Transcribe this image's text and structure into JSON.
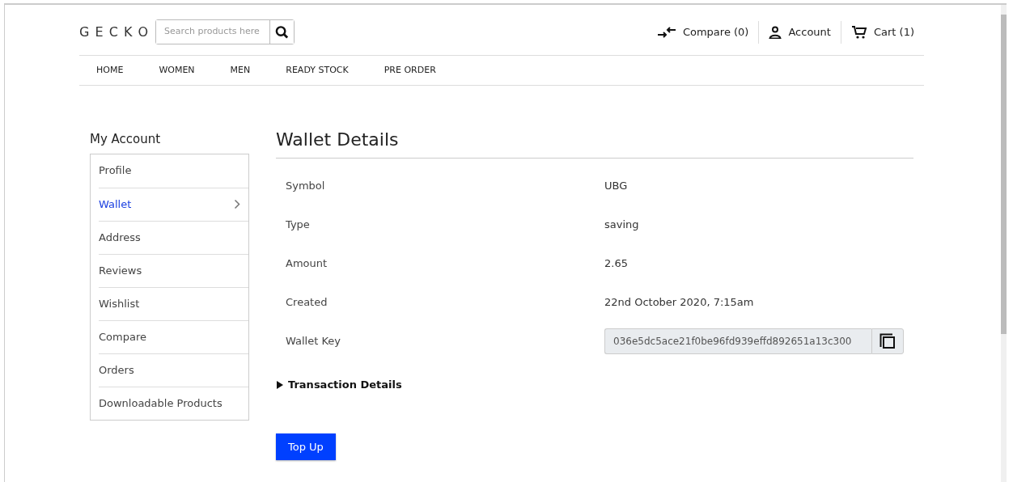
{
  "brand": "G E C K O",
  "search": {
    "placeholder": "Search products here"
  },
  "header_links": [
    {
      "kind": "compare",
      "label": "Compare (0)"
    },
    {
      "kind": "account",
      "label": "Account"
    },
    {
      "kind": "cart",
      "label": "Cart (1)"
    }
  ],
  "nav": [
    "HOME",
    "WOMEN",
    "MEN",
    "READY STOCK",
    "PRE ORDER"
  ],
  "sidebar": {
    "title": "My Account",
    "items": [
      {
        "label": "Profile",
        "selected": false
      },
      {
        "label": "Wallet",
        "selected": true
      },
      {
        "label": "Address",
        "selected": false
      },
      {
        "label": "Reviews",
        "selected": false
      },
      {
        "label": "Wishlist",
        "selected": false
      },
      {
        "label": "Compare",
        "selected": false
      },
      {
        "label": "Orders",
        "selected": false
      },
      {
        "label": "Downloadable Products",
        "selected": false
      }
    ]
  },
  "main": {
    "title": "Wallet Details",
    "fields": [
      {
        "kind": "text",
        "label": "Symbol",
        "value": "UBG"
      },
      {
        "kind": "text",
        "label": "Type",
        "value": "saving"
      },
      {
        "kind": "text",
        "label": "Amount",
        "value": "2.65"
      },
      {
        "kind": "text",
        "label": "Created",
        "value": "22nd October 2020, 7:15am"
      },
      {
        "kind": "key",
        "label": "Wallet Key",
        "value": "036e5dc5ace21f0be96fd939effd892651a13c300"
      }
    ],
    "transaction_details": {
      "label": "Transaction Details",
      "expanded": false
    },
    "button": "Top Up"
  }
}
